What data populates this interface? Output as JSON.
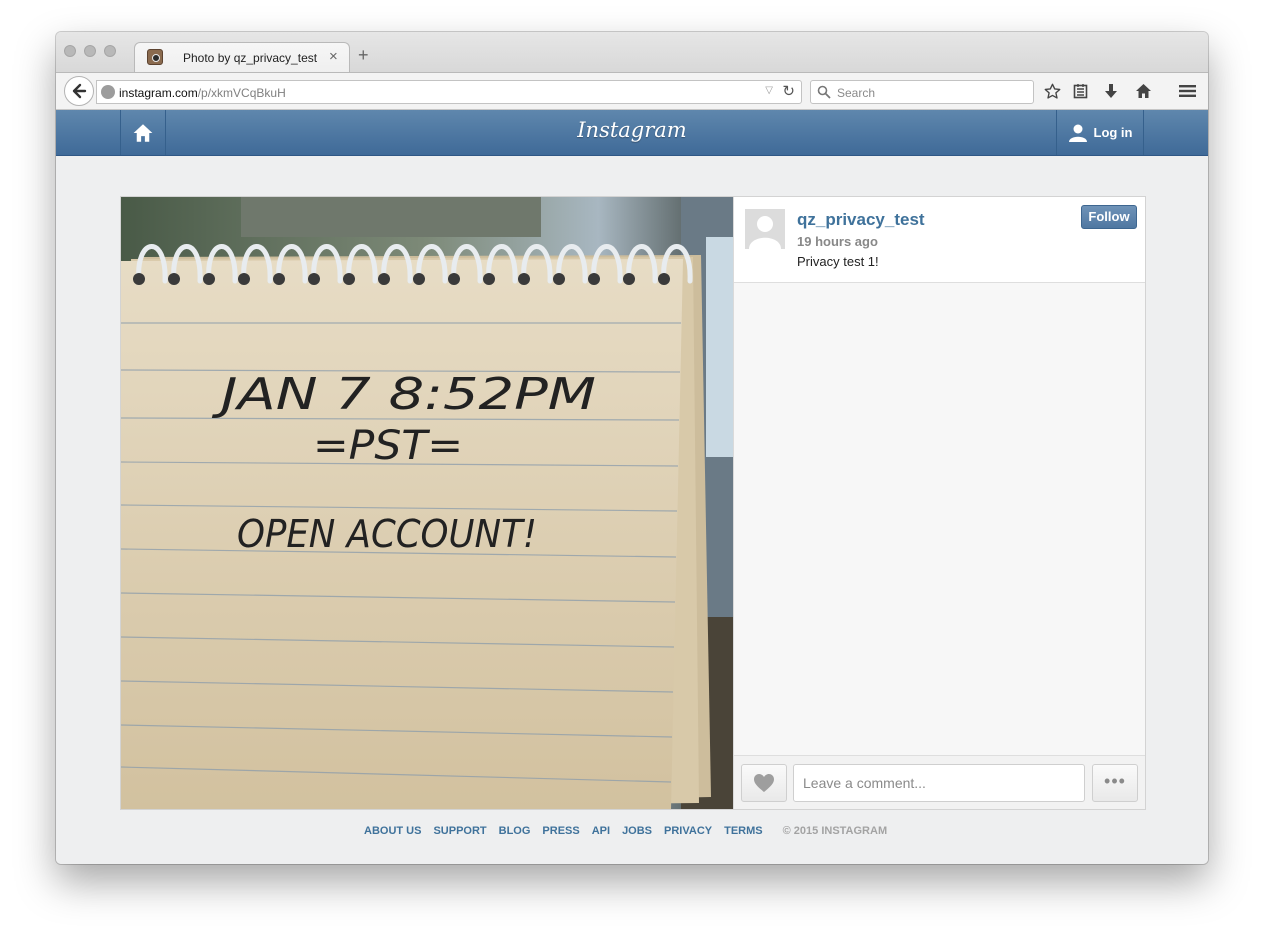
{
  "browser": {
    "tab_title": "Photo by qz_privacy_test",
    "tab_close": "×",
    "new_tab": "+",
    "url_host": "instagram.com",
    "url_path": "/p/xkmVCqBkuH",
    "search_placeholder": "Search"
  },
  "instagram": {
    "logo": "Instagram",
    "login_label": "Log in"
  },
  "post": {
    "username": "qz_privacy_test",
    "time_ago": "19 hours ago",
    "caption": "Privacy test 1!",
    "follow_label": "Follow",
    "comment_placeholder": "Leave a comment...",
    "more_label": "•••",
    "photo_note": {
      "line1": "JAN 7  8:52PM",
      "line2": "=PST=",
      "line3": "OPEN  ACCOUNT!"
    }
  },
  "footer": {
    "links": [
      "ABOUT US",
      "SUPPORT",
      "BLOG",
      "PRESS",
      "API",
      "JOBS",
      "PRIVACY",
      "TERMS"
    ],
    "copyright": "© 2015 INSTAGRAM"
  },
  "colors": {
    "ig_blue": "#3f729b",
    "header_blue": "#4f77a1"
  },
  "icons": [
    "back-arrow-icon",
    "globe-icon",
    "reload-icon",
    "search-icon",
    "bookmark-star-icon",
    "reading-list-icon",
    "download-icon",
    "home-icon",
    "hamburger-menu-icon",
    "instagram-favicon",
    "user-icon",
    "heart-icon"
  ]
}
